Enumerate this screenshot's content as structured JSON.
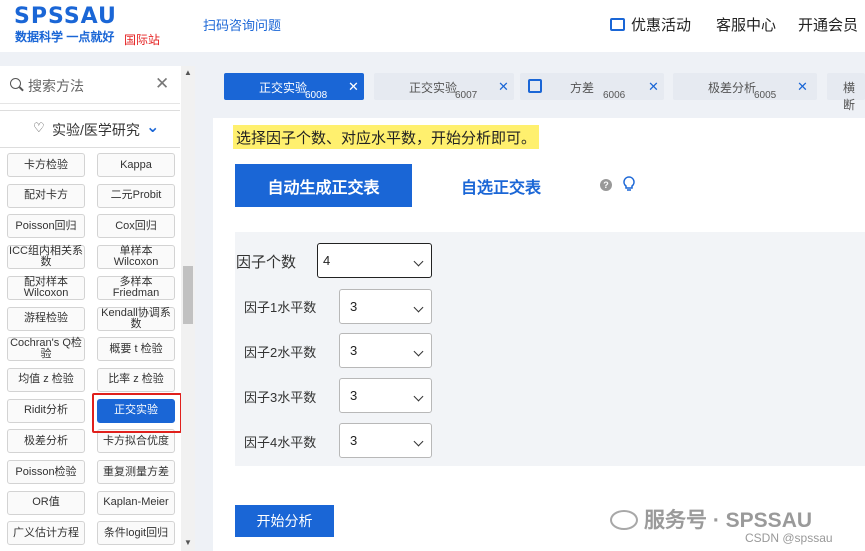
{
  "header": {
    "logo": "SPSSAU",
    "slogan": "数据科学 一点就好",
    "intl": "国际站",
    "scan_link": "扫码咨询问题",
    "nav": [
      "优惠活动",
      "客服中心",
      "开通会员"
    ]
  },
  "sidebar": {
    "search_placeholder": "搜索方法",
    "category": "实验/医学研究",
    "items": [
      [
        "卡方检验",
        "Kappa"
      ],
      [
        "配对卡方",
        "二元Probit"
      ],
      [
        "Poisson回归",
        "Cox回归"
      ],
      [
        "ICC组内相关系数",
        "单样本Wilcoxon"
      ],
      [
        "配对样本Wilcoxon",
        "多样本Friedman"
      ],
      [
        "游程检验",
        "Kendall协调系数"
      ],
      [
        "Cochran's Q检验",
        "概要 t 检验"
      ],
      [
        "均值 z 检验",
        "比率 z 检验"
      ],
      [
        "Ridit分析",
        "正交实验"
      ],
      [
        "极差分析",
        "卡方拟合优度"
      ],
      [
        "Poisson检验",
        "重复测量方差"
      ],
      [
        "OR值",
        "Kaplan-Meier"
      ],
      [
        "广义估计方程",
        "条件logit回归"
      ]
    ],
    "active_item": "正交实验"
  },
  "tabs": [
    {
      "label": "正交实验",
      "id": "6008"
    },
    {
      "label": "正交实验",
      "id": "6007"
    },
    {
      "label": "方差",
      "id": "6006"
    },
    {
      "label": "极差分析",
      "id": "6005"
    },
    {
      "label": "横断"
    }
  ],
  "main": {
    "hint": "选择因子个数、对应水平数，开始分析即可。",
    "segment_auto": "自动生成正交表",
    "segment_custom": "自选正交表",
    "factor_count_label": "因子个数",
    "factor_count_value": "4",
    "levels": [
      {
        "label": "因子1水平数",
        "value": "3"
      },
      {
        "label": "因子2水平数",
        "value": "3"
      },
      {
        "label": "因子3水平数",
        "value": "3"
      },
      {
        "label": "因子4水平数",
        "value": "3"
      }
    ],
    "start_button": "开始分析"
  },
  "watermark": "服务号 · SPSSAU",
  "csdn": "CSDN @spssau",
  "colors": {
    "accent": "#1a66d6",
    "highlight": "#fff06e",
    "alert": "#e0201c"
  }
}
